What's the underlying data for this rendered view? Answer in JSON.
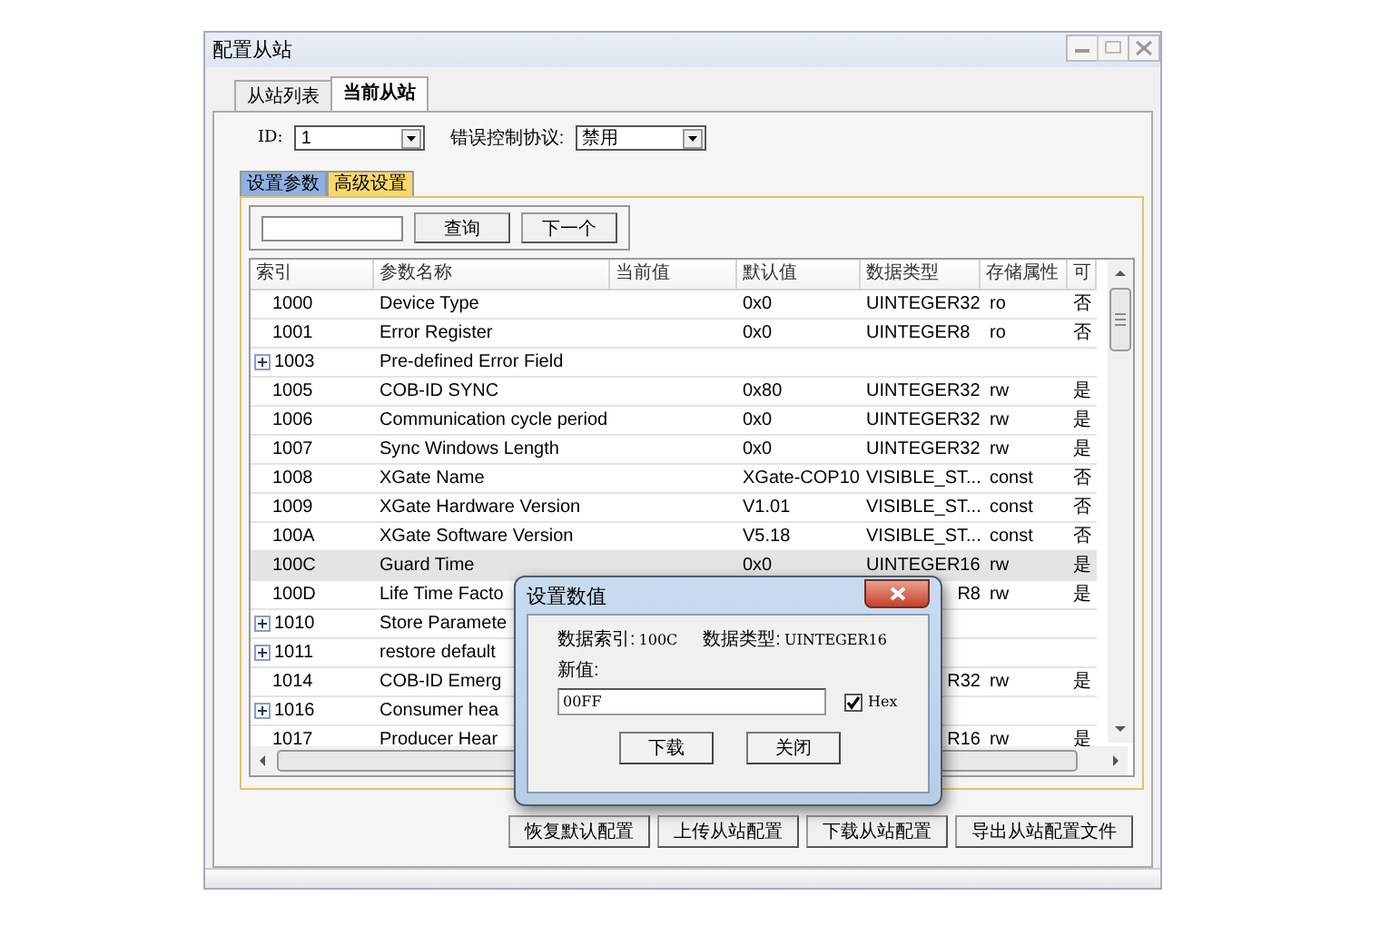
{
  "window": {
    "title": "配置从站"
  },
  "outer_tabs": [
    {
      "label": "从站列表",
      "selected": false
    },
    {
      "label": "当前从站",
      "selected": true
    }
  ],
  "id_field": {
    "label": "ID:",
    "value": "1"
  },
  "error_control": {
    "label": "错误控制协议:",
    "value": "禁用"
  },
  "inner_tabs": [
    {
      "label": "设置参数",
      "selected": false
    },
    {
      "label": "高级设置",
      "selected": true
    }
  ],
  "search": {
    "query_button": "查询",
    "next_button": "下一个"
  },
  "table": {
    "columns": [
      "索引",
      "参数名称",
      "当前值",
      "默认值",
      "数据类型",
      "存储属性",
      "可"
    ],
    "rows": [
      {
        "kind": "entry",
        "selected": false,
        "cells": [
          "1000",
          "Device Type",
          "",
          "0x0",
          "UINTEGER32",
          "ro",
          "否"
        ]
      },
      {
        "kind": "entry",
        "selected": false,
        "cells": [
          "1001",
          "Error Register",
          "",
          "0x0",
          "UINTEGER8",
          "ro",
          "否"
        ]
      },
      {
        "kind": "group",
        "selected": false,
        "cells": [
          "1003",
          "Pre-defined Error Field",
          "",
          "",
          "",
          "",
          ""
        ]
      },
      {
        "kind": "entry",
        "selected": false,
        "cells": [
          "1005",
          "COB-ID SYNC",
          "",
          "0x80",
          "UINTEGER32",
          "rw",
          "是"
        ]
      },
      {
        "kind": "entry",
        "selected": false,
        "cells": [
          "1006",
          "Communication cycle period",
          "",
          "0x0",
          "UINTEGER32",
          "rw",
          "是"
        ]
      },
      {
        "kind": "entry",
        "selected": false,
        "cells": [
          "1007",
          "Sync Windows Length",
          "",
          "0x0",
          "UINTEGER32",
          "rw",
          "是"
        ]
      },
      {
        "kind": "entry",
        "selected": false,
        "cells": [
          "1008",
          "XGate Name",
          "",
          "XGate-COP10",
          "VISIBLE_ST...",
          "const",
          "否"
        ]
      },
      {
        "kind": "entry",
        "selected": false,
        "cells": [
          "1009",
          "XGate Hardware Version",
          "",
          "V1.01",
          "VISIBLE_ST...",
          "const",
          "否"
        ]
      },
      {
        "kind": "entry",
        "selected": false,
        "cells": [
          "100A",
          "XGate Software Version",
          "",
          "V5.18",
          "VISIBLE_ST...",
          "const",
          "否"
        ]
      },
      {
        "kind": "entry",
        "selected": true,
        "cells": [
          "100C",
          "Guard Time",
          "",
          "0x0",
          "UINTEGER16",
          "rw",
          "是"
        ]
      },
      {
        "kind": "entry",
        "selected": false,
        "cells": [
          "100D",
          "Life Time Facto",
          "",
          "",
          "R8",
          "rw",
          "是"
        ]
      },
      {
        "kind": "group",
        "selected": false,
        "cells": [
          "1010",
          "Store Paramete",
          "",
          "",
          "",
          "",
          ""
        ]
      },
      {
        "kind": "group",
        "selected": false,
        "cells": [
          "1011",
          "restore default",
          "",
          "",
          "",
          "",
          ""
        ]
      },
      {
        "kind": "entry",
        "selected": false,
        "cells": [
          "1014",
          "COB-ID Emerg",
          "",
          "",
          "R32",
          "rw",
          "是"
        ]
      },
      {
        "kind": "group",
        "selected": false,
        "cells": [
          "1016",
          "Consumer hea",
          "",
          "",
          "",
          "",
          ""
        ]
      },
      {
        "kind": "entry",
        "selected": false,
        "cells": [
          "1017",
          "Producer Hear",
          "",
          "",
          "R16",
          "rw",
          "是"
        ]
      }
    ]
  },
  "bottom_buttons": [
    "恢复默认配置",
    "上传从站配置",
    "下载从站配置",
    "导出从站配置文件"
  ],
  "dialog": {
    "title": "设置数值",
    "index_label": "数据索引:",
    "index_value": "100C",
    "type_label": "数据类型:",
    "type_value": "UINTEGER16",
    "new_value_label": "新值:",
    "new_value": "00FF",
    "hex": {
      "label": "Hex",
      "checked": true
    },
    "buttons": [
      "下载",
      "关闭"
    ]
  }
}
